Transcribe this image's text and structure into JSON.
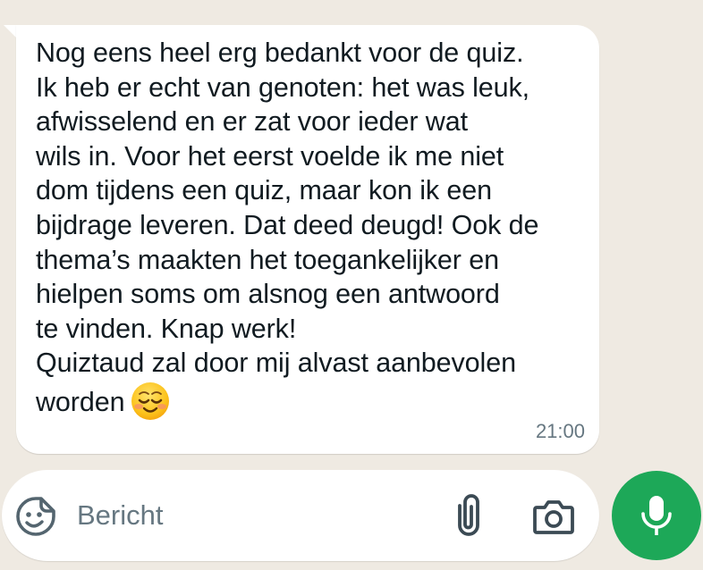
{
  "message": {
    "lines": [
      "Nog eens heel erg bedankt voor de quiz.",
      "Ik heb er echt van genoten: het was leuk,",
      "afwisselend en er zat voor ieder wat",
      "wils in. Voor het eerst voelde ik me niet",
      "dom tijdens een quiz, maar kon ik een",
      "bijdrage leveren. Dat deed deugd! Ook de",
      "thema’s maakten het toegankelijker en",
      "hielpen soms om alsnog een antwoord",
      "te vinden. Knap werk!",
      "Quiztaud zal door mij alvast aanbevolen",
      "worden"
    ],
    "emoji": "smiling-face-with-smiling-eyes",
    "time": "21:00"
  },
  "composer": {
    "placeholder": "Bericht",
    "value": ""
  },
  "icons": {
    "sticker": "sticker-icon",
    "attach": "paperclip-icon",
    "camera": "camera-icon",
    "mic": "microphone-icon"
  },
  "colors": {
    "chat_background": "#efeae2",
    "bubble": "#ffffff",
    "text": "#111b21",
    "meta": "#667781",
    "mic_button": "#1da858"
  }
}
